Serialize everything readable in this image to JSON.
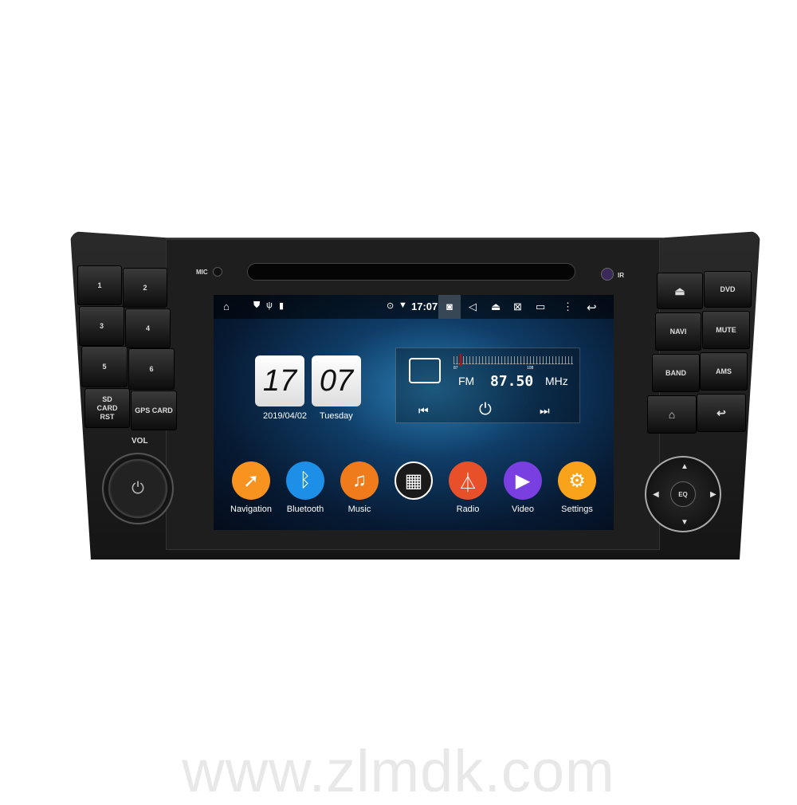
{
  "panel": {
    "mic": "MIC",
    "ir": "IR",
    "vol": "VOL",
    "left_buttons": [
      "1",
      "2",
      "3",
      "4",
      "5",
      "6",
      "SD CARD RST",
      "GPS CARD"
    ],
    "right_buttons": [
      "⏏",
      "DVD",
      "NAVI",
      "MUTE",
      "BAND",
      "AMS",
      "⌂",
      "↩"
    ],
    "dpad": {
      "center": "EQ",
      "up": "▲",
      "down": "▼",
      "left": "◀",
      "right": "▶"
    }
  },
  "status": {
    "time": "17:07",
    "icons": [
      "home-icon",
      "shield-icon",
      "usb-icon",
      "sd-icon",
      "location-icon",
      "wifi-icon",
      "camera-icon",
      "volume-icon",
      "eject-icon",
      "screen-icon",
      "recent-apps-icon",
      "more-icon",
      "back-icon"
    ]
  },
  "clock": {
    "hours": "17",
    "minutes": "07",
    "date": "2019/04/02",
    "weekday": "Tuesday"
  },
  "radio": {
    "band": "FM",
    "frequency": "87.50",
    "unit": "MHz",
    "scale_min": "87",
    "scale_max": "108"
  },
  "apps": [
    {
      "label": "Navigation",
      "color": "#f7931e",
      "glyph": "➚"
    },
    {
      "label": "Bluetooth",
      "color": "#1e8fe6",
      "glyph": "ᛒ"
    },
    {
      "label": "Music",
      "color": "#f07b1a",
      "glyph": "♫"
    },
    {
      "label": "",
      "color": "#1a1a1a",
      "glyph": "▦"
    },
    {
      "label": "Radio",
      "color": "#e8502a",
      "glyph": "⏃"
    },
    {
      "label": "Video",
      "color": "#7a3fe0",
      "glyph": "▶"
    },
    {
      "label": "Settings",
      "color": "#f9a31a",
      "glyph": "⚙"
    }
  ],
  "watermark": "www.zlmdk.com"
}
